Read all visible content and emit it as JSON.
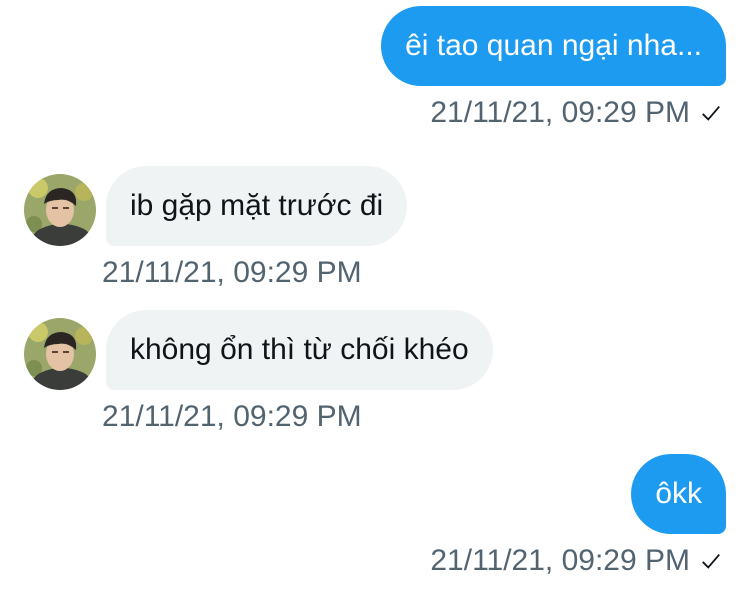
{
  "messages": [
    {
      "direction": "sent",
      "text": "êi tao quan ngại nha...",
      "timestamp": "21/11/21, 09:29 PM",
      "read_icon": "check-icon"
    },
    {
      "direction": "received",
      "text": "ib gặp mặt trước đi",
      "timestamp": "21/11/21, 09:29 PM",
      "avatar": "user-avatar"
    },
    {
      "direction": "received",
      "text": "không ổn thì từ chối khéo",
      "timestamp": "21/11/21, 09:29 PM",
      "avatar": "user-avatar"
    },
    {
      "direction": "sent",
      "text": "ôkk",
      "timestamp": "21/11/21, 09:29 PM",
      "read_icon": "check-icon"
    }
  ],
  "colors": {
    "sent_bubble": "#1d9bf0",
    "received_bubble": "#eff3f4",
    "timestamp_text": "#536471"
  }
}
